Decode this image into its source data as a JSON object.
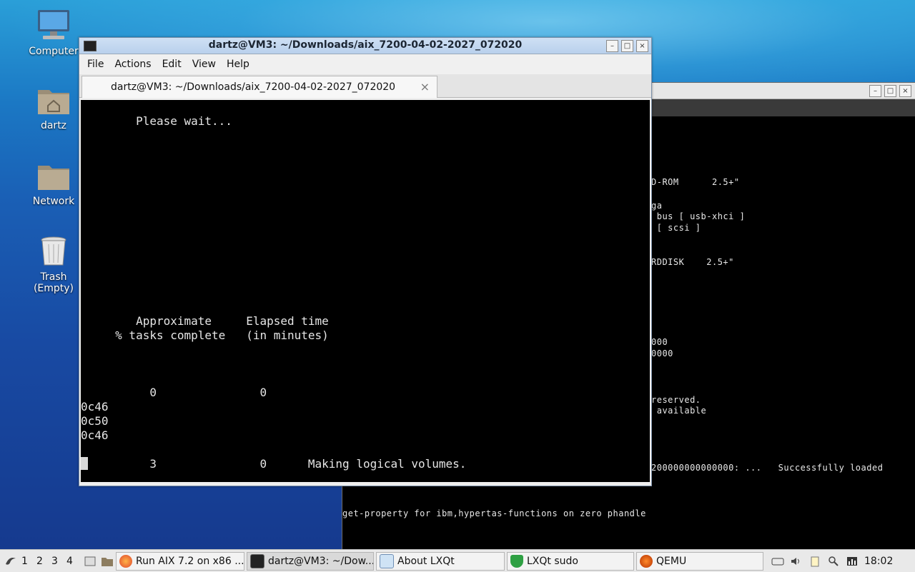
{
  "desktop": {
    "icons": [
      {
        "label": "Computer",
        "icon": "computer-icon"
      },
      {
        "label": "dartz",
        "icon": "home-folder-icon"
      },
      {
        "label": "Network",
        "icon": "network-folder-icon"
      },
      {
        "label": "Trash (Empty)",
        "icon": "trash-icon"
      }
    ]
  },
  "qemu_window": {
    "lines": [
      "D-ROM      2.5+\"",
      "ga",
      " bus [ usb-xhci ]",
      " [ scsi ]",
      "RDDISK    2.5+\"",
      "000",
      "0000",
      "reserved.",
      " available",
      "200000000000000: ...   Successfully loaded",
      "get-property for ibm,hypertas-functions on zero phandle"
    ]
  },
  "terminal": {
    "title": "dartz@VM3: ~/Downloads/aix_7200-04-02-2027_072020",
    "menu": [
      "File",
      "Actions",
      "Edit",
      "View",
      "Help"
    ],
    "tab_label": "dartz@VM3: ~/Downloads/aix_7200-04-02-2027_072020",
    "lines": {
      "wait": "        Please wait...",
      "h1": "        Approximate     Elapsed time",
      "h2": "     % tasks complete   (in minutes)",
      "r1": "          0               0",
      "c1": "0c46",
      "c2": "0c50",
      "c3": "0c46",
      "r2": "          3               0      Making logical volumes."
    }
  },
  "taskbar": {
    "desktops": [
      "1",
      "2",
      "3",
      "4"
    ],
    "tasks": [
      {
        "label": "Run AIX 7.2 on x86 ...",
        "icon": "firefox-icon"
      },
      {
        "label": "dartz@VM3: ~/Dow...",
        "icon": "terminal-icon"
      },
      {
        "label": "About LXQt",
        "icon": "lxqt-icon"
      },
      {
        "label": "LXQt sudo",
        "icon": "shield-icon"
      },
      {
        "label": "QEMU",
        "icon": "qemu-icon"
      }
    ],
    "clock": "18:02"
  }
}
